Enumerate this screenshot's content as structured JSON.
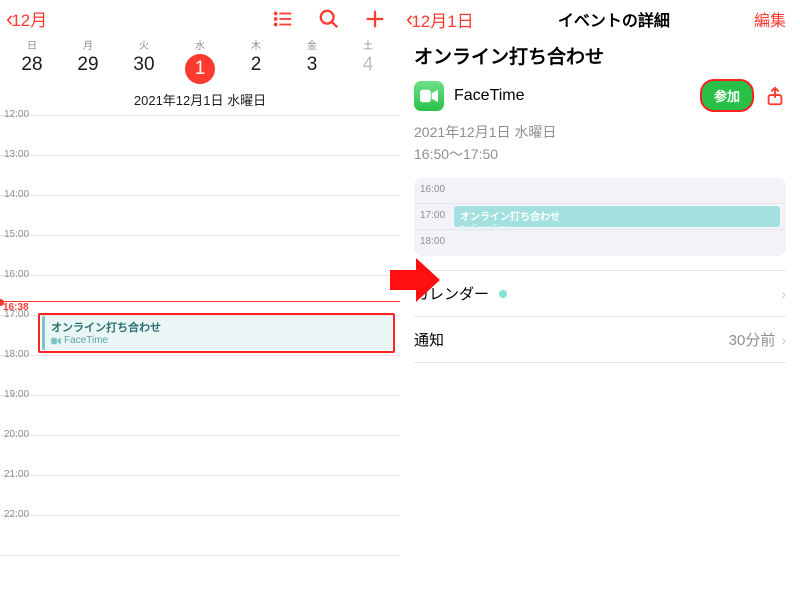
{
  "left": {
    "back_label": "12月",
    "dows": [
      "日",
      "月",
      "火",
      "水",
      "木",
      "金",
      "土"
    ],
    "dates": [
      {
        "n": "28",
        "dim": false
      },
      {
        "n": "29",
        "dim": false
      },
      {
        "n": "30",
        "dim": false
      },
      {
        "n": "1",
        "dim": false,
        "selected": true
      },
      {
        "n": "2",
        "dim": false
      },
      {
        "n": "3",
        "dim": false
      },
      {
        "n": "4",
        "dim": true
      }
    ],
    "full_date": "2021年12月1日 水曜日",
    "hours": [
      "12:00",
      "13:00",
      "14:00",
      "15:00",
      "16:00",
      "17:00",
      "18:00",
      "19:00",
      "20:00",
      "21:00",
      "22:00"
    ],
    "now_time": "16:38",
    "event": {
      "title": "オンライン打ち合わせ",
      "sub": "FaceTime"
    }
  },
  "right": {
    "back_label": "12月1日",
    "nav_title": "イベントの詳細",
    "edit_label": "編集",
    "event_title": "オンライン打ち合わせ",
    "facetime_label": "FaceTime",
    "join_label": "参加",
    "date_str": "2021年12月1日 水曜日",
    "time_str": "16:50〜17:50",
    "mini_hours": [
      "16:00",
      "17:00",
      "18:00"
    ],
    "mini_event": {
      "title": "オンライン打ち合わせ",
      "sub": "FaceTime"
    },
    "rows": {
      "calendar_lbl": "カレンダー",
      "notify_lbl": "通知",
      "notify_val": "30分前"
    }
  }
}
